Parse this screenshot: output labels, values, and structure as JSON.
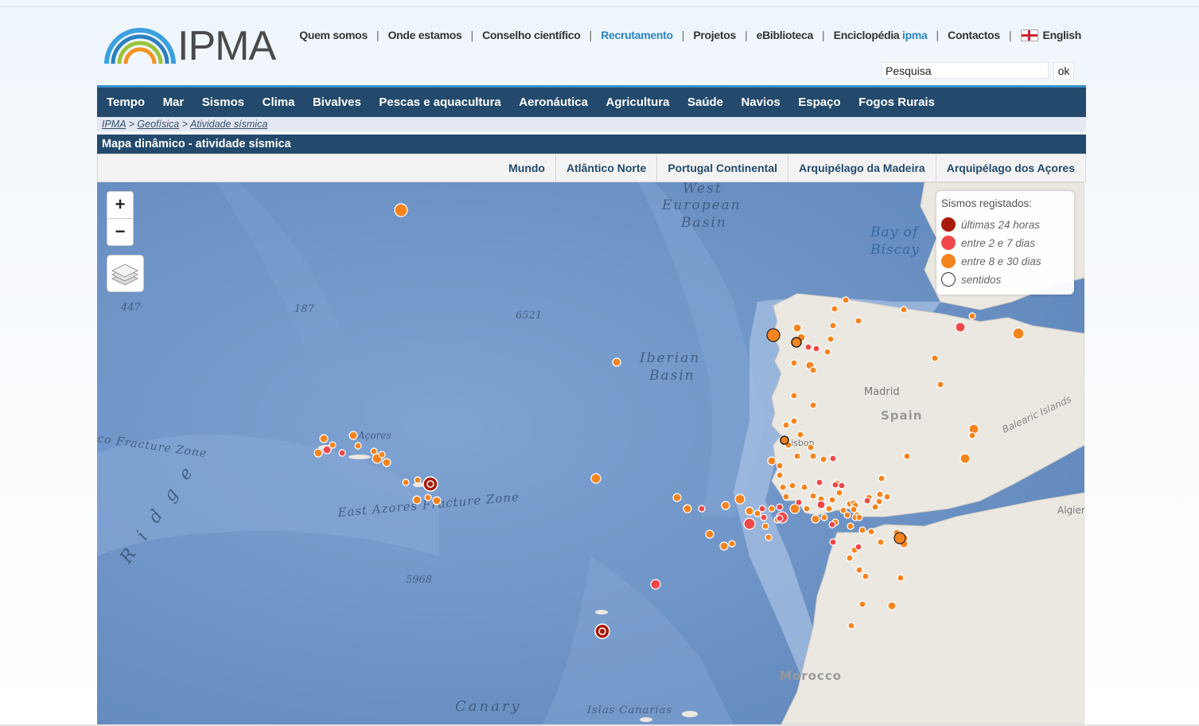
{
  "logo_text": "IPMA",
  "top_links": [
    "Quem somos",
    "Onde estamos",
    "Conselho científico",
    "Recrutamento",
    "Projetos",
    "eBiblioteca"
  ],
  "enciclopedia": {
    "label": "Enciclopédia",
    "accent": "ipma"
  },
  "contactos": "Contactos",
  "english": "English",
  "search": {
    "value": "Pesquisa",
    "button": "ok"
  },
  "main_nav": [
    "Tempo",
    "Mar",
    "Sismos",
    "Clima",
    "Bivalves",
    "Pescas e aquacultura",
    "Aeronáutica",
    "Agricultura",
    "Saúde",
    "Navios",
    "Espaço",
    "Fogos Rurais"
  ],
  "breadcrumb": {
    "home": "IPMA",
    "level1": "Geofísica",
    "level2": "Atividade sísmica",
    "sep": ">"
  },
  "page_title": "Mapa dinâmico - atividade sísmica",
  "region_tabs": [
    "Mundo",
    "Atlântico Norte",
    "Portugal Continental",
    "Arquipélago da Madeira",
    "Arquipélago dos Açores"
  ],
  "zoom": {
    "in": "+",
    "out": "−"
  },
  "legend": {
    "title": "Sismos registados:",
    "items": [
      {
        "label": "últimas 24 horas",
        "color": "#a81a0a"
      },
      {
        "label": "entre 2 e 7 dias",
        "color": "#f04848"
      },
      {
        "label": "entre 8 e 30 dias",
        "color": "#f5841f"
      },
      {
        "label": "sentidos",
        "color": "#ffffff"
      }
    ]
  },
  "map_labels": {
    "west_european_1": "West",
    "west_european_2": "European",
    "west_european_3": "Basin",
    "bay_1": "Bay of",
    "bay_2": "Biscay",
    "iberian_1": "Iberian",
    "iberian_2": "Basin",
    "fracture_west": "co Fracture Zone",
    "east_azores": "East Azores Fracture Zone",
    "ridge": "R i d g e",
    "acores": "Açores",
    "madrid": "Madrid",
    "spain": "Spain",
    "balearic": "Balearic Islands",
    "lisbon": "Lisbon",
    "morocco": "Morocco",
    "algiers": "Algier",
    "canary": "Canary",
    "islas": "Islas Canarias",
    "d447": "447",
    "d187": "187",
    "d6521": "6521",
    "d5968": "5968"
  },
  "colors": {
    "nav": "#234a6c",
    "accent": "#2a85c4",
    "ocean": "#6d93c5",
    "land": "#ebe8e2"
  }
}
